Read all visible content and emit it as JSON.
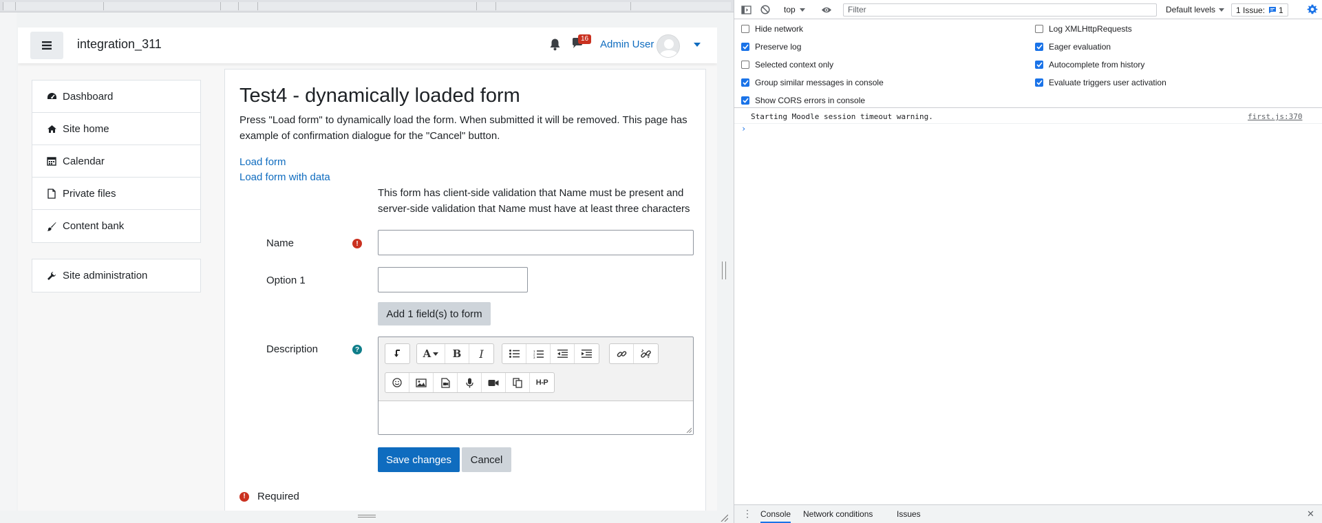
{
  "site": {
    "name": "integration_311",
    "notification_count": "16",
    "user_name": "Admin User"
  },
  "nav": {
    "items": [
      {
        "label": "Dashboard",
        "icon": "dashboard-icon"
      },
      {
        "label": "Site home",
        "icon": "home-icon"
      },
      {
        "label": "Calendar",
        "icon": "calendar-icon"
      },
      {
        "label": "Private files",
        "icon": "file-icon"
      },
      {
        "label": "Content bank",
        "icon": "brush-icon"
      }
    ],
    "admin": {
      "label": "Site administration",
      "icon": "wrench-icon"
    }
  },
  "main": {
    "title": "Test4 - dynamically loaded form",
    "intro": "Press \"Load form\" to dynamically load the form. When submitted it will be removed. This page has example of confirmation dialogue for the \"Cancel\" button.",
    "links": [
      "Load form",
      "Load form with data"
    ],
    "form_note": "This form has client-side validation that Name must be present and server-side validation that Name must have at least three characters",
    "fields": {
      "name_label": "Name",
      "name_value": "",
      "option1_label": "Option 1",
      "option1_value": "",
      "add_field_button": "Add 1 field(s) to form",
      "description_label": "Description",
      "hp_label": "H-P"
    },
    "buttons": {
      "save": "Save changes",
      "cancel": "Cancel"
    },
    "required_label": "Required"
  },
  "devtools": {
    "context": "top",
    "filter_placeholder": "Filter",
    "levels": "Default levels",
    "issues": "1 Issue:",
    "issues_count": "1",
    "settings_left": [
      {
        "label": "Hide network",
        "checked": false
      },
      {
        "label": "Preserve log",
        "checked": true
      },
      {
        "label": "Selected context only",
        "checked": false
      },
      {
        "label": "Group similar messages in console",
        "checked": true
      },
      {
        "label": "Show CORS errors in console",
        "checked": true
      }
    ],
    "settings_right": [
      {
        "label": "Log XMLHttpRequests",
        "checked": false
      },
      {
        "label": "Eager evaluation",
        "checked": true
      },
      {
        "label": "Autocomplete from history",
        "checked": true
      },
      {
        "label": "Evaluate triggers user activation",
        "checked": true
      }
    ],
    "message": {
      "text": "Starting Moodle session timeout warning.",
      "source": "first.js:370"
    },
    "prompt": "›",
    "drawer_tabs": [
      "Console",
      "Network conditions",
      "Issues"
    ]
  },
  "colors": {
    "brand_primary": "#0f6cbf",
    "danger": "#ca3120",
    "info": "#0f7e8a",
    "devtools_accent": "#1a73e8"
  }
}
